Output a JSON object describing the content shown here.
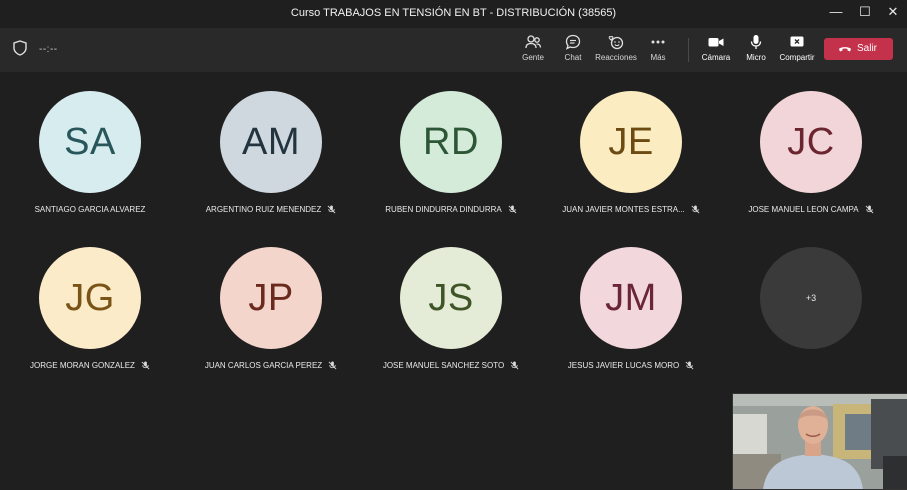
{
  "window": {
    "title": "Curso TRABAJOS EN TENSIÓN EN BT - DISTRIBUCIÓN (38565)",
    "minimize": "—",
    "maximize": "☐",
    "close": "✕"
  },
  "toolbar": {
    "timer": "--:--",
    "people": "Gente",
    "chat": "Chat",
    "reactions": "Reacciones",
    "more": "Más",
    "camera": "Cámara",
    "mic": "Micro",
    "share": "Compartir",
    "leave": "Salir",
    "leave_color": "#c4314b"
  },
  "participants": [
    {
      "initials": "SA",
      "name": "SANTIAGO GARCIA ALVAREZ",
      "bg": "#d7ecef",
      "fg": "#27565b",
      "muted": false
    },
    {
      "initials": "AM",
      "name": "ARGENTINO RUIZ MENENDEZ",
      "bg": "#cfd8df",
      "fg": "#23343f",
      "muted": true
    },
    {
      "initials": "RD",
      "name": "RUBEN DINDURRA DINDURRA",
      "bg": "#d4ebd9",
      "fg": "#2c5636",
      "muted": true
    },
    {
      "initials": "JE",
      "name": "JUAN JAVIER MONTES ESTRA...",
      "bg": "#fbedc1",
      "fg": "#6b4b11",
      "muted": true
    },
    {
      "initials": "JC",
      "name": "JOSE MANUEL LEON CAMPA",
      "bg": "#f2d5d8",
      "fg": "#6a2530",
      "muted": true
    },
    {
      "initials": "JG",
      "name": "JORGE MORAN GONZALEZ",
      "bg": "#fcebc8",
      "fg": "#7a5416",
      "muted": true
    },
    {
      "initials": "JP",
      "name": "JUAN CARLOS GARCIA PEREZ",
      "bg": "#f3d5cc",
      "fg": "#6a2b1e",
      "muted": true
    },
    {
      "initials": "JS",
      "name": "JOSE MANUEL SANCHEZ SOTO",
      "bg": "#e4ecd7",
      "fg": "#3f5528",
      "muted": true
    },
    {
      "initials": "JM",
      "name": "JESUS JAVIER LUCAS MORO",
      "bg": "#f2d7dd",
      "fg": "#6a2636",
      "muted": true
    }
  ],
  "overflow_count": "+3"
}
